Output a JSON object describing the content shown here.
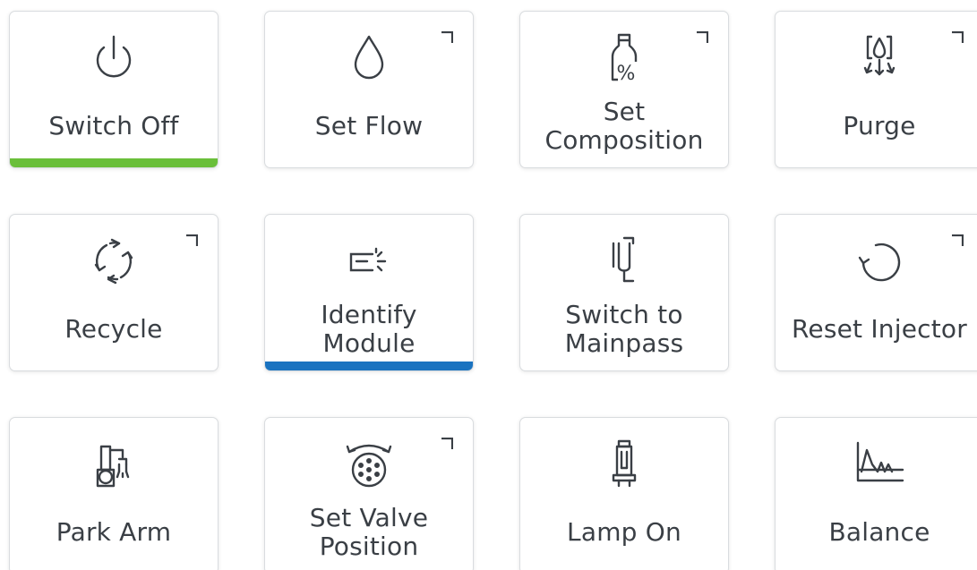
{
  "accents": {
    "green": "#6abf3a",
    "blue": "#1a73c0"
  },
  "tiles": [
    {
      "label": "Switch Off",
      "icon": "power-icon",
      "corner": false,
      "bar": "green"
    },
    {
      "label": "Set Flow",
      "icon": "drop-icon",
      "corner": true,
      "bar": null
    },
    {
      "label": "Set\nComposition",
      "icon": "bottle-percent-icon",
      "corner": true,
      "bar": null
    },
    {
      "label": "Purge",
      "icon": "purge-icon",
      "corner": true,
      "bar": null
    },
    {
      "label": "Recycle",
      "icon": "recycle-icon",
      "corner": true,
      "bar": null
    },
    {
      "label": "Identify\nModule",
      "icon": "identify-module-icon",
      "corner": false,
      "bar": "blue"
    },
    {
      "label": "Switch to\nMainpass",
      "icon": "mainpass-icon",
      "corner": false,
      "bar": null
    },
    {
      "label": "Reset Injector",
      "icon": "reset-icon",
      "corner": true,
      "bar": null
    },
    {
      "label": "Park Arm",
      "icon": "robot-arm-icon",
      "corner": false,
      "bar": null
    },
    {
      "label": "Set Valve\nPosition",
      "icon": "valve-icon",
      "corner": true,
      "bar": null
    },
    {
      "label": "Lamp On",
      "icon": "lamp-icon",
      "corner": false,
      "bar": null
    },
    {
      "label": "Balance",
      "icon": "balance-chart-icon",
      "corner": false,
      "bar": null
    }
  ]
}
